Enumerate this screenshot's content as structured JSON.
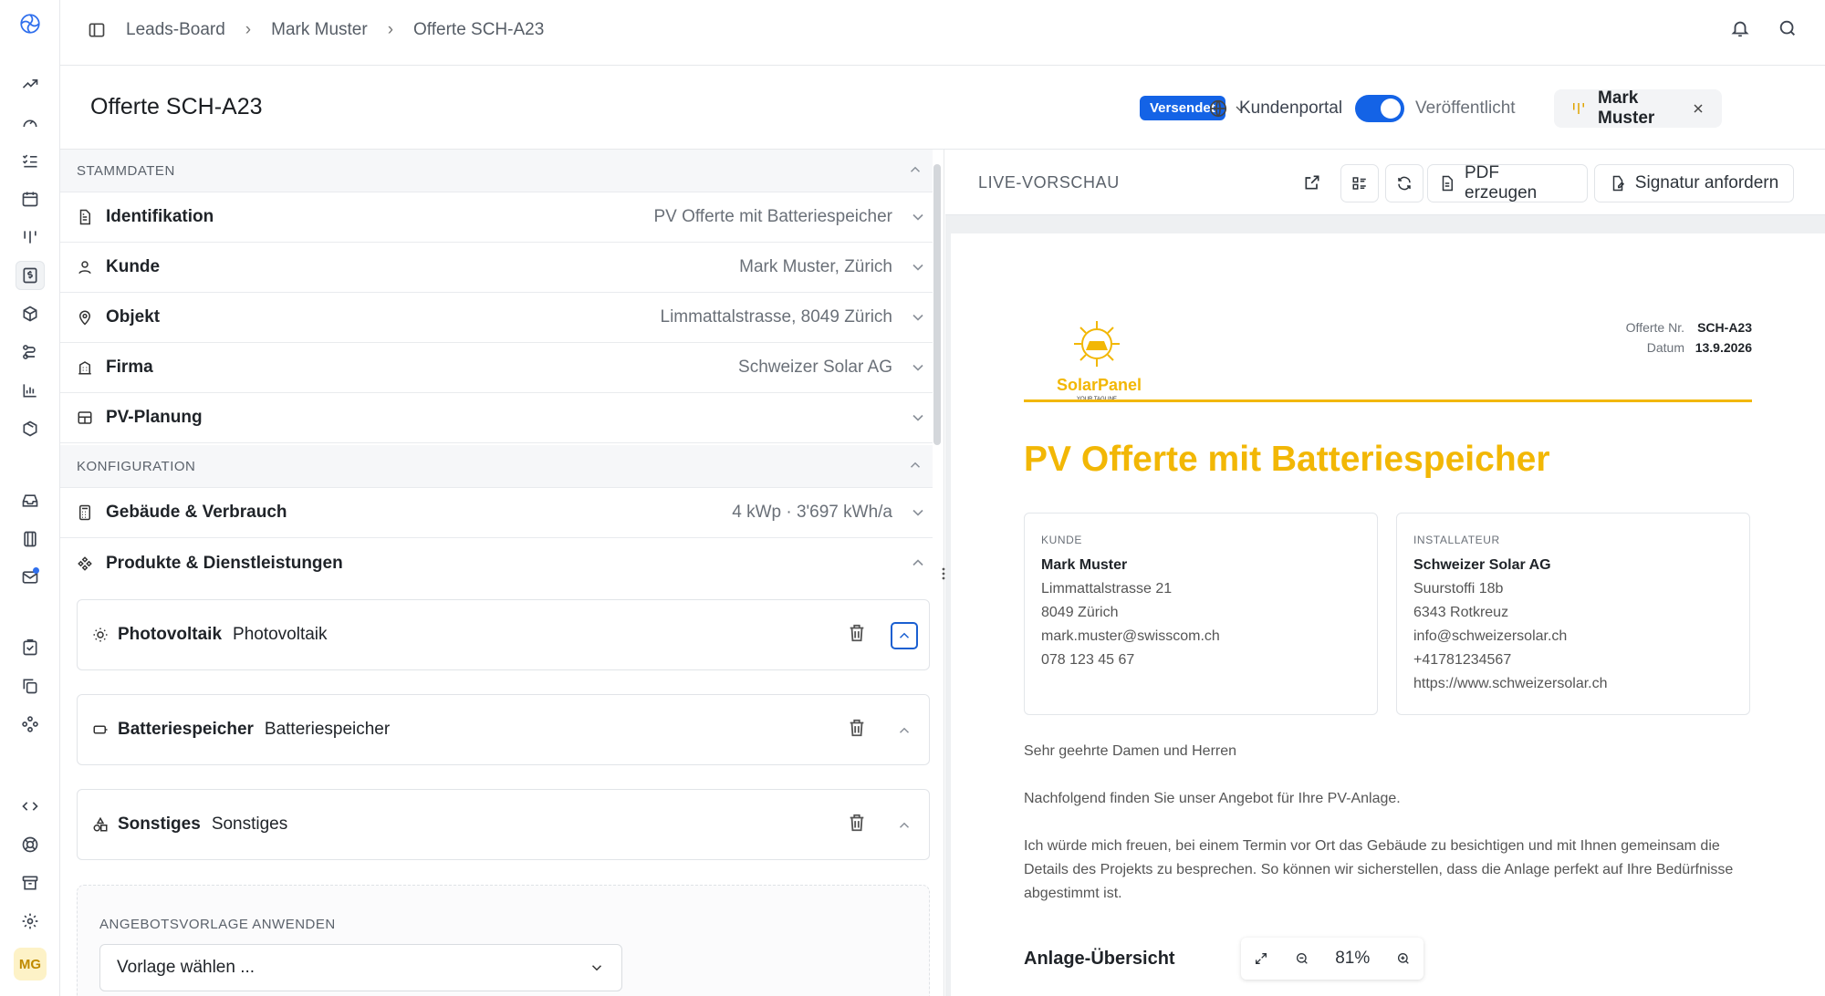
{
  "breadcrumb": [
    "Leads-Board",
    "Mark Muster",
    "Offerte SCH-A23"
  ],
  "page_title": "Offerte SCH-A23",
  "status": {
    "badge": "Versendet"
  },
  "portal": {
    "label": "Kundenportal",
    "published_label": "Veröffentlicht",
    "published": true
  },
  "user_chip": {
    "name": "Mark Muster"
  },
  "accent_color": "#1463e6",
  "brand_color": "#f2b705",
  "sections": {
    "stammdaten": {
      "title": "STAMMDATEN",
      "rows": [
        {
          "icon": "document-icon",
          "label": "Identifikation",
          "value": "PV Offerte mit Batteriespeicher"
        },
        {
          "icon": "user-icon",
          "label": "Kunde",
          "value": "Mark Muster, Zürich"
        },
        {
          "icon": "map-pin-icon",
          "label": "Objekt",
          "value": "Limmattalstrasse, 8049 Zürich"
        },
        {
          "icon": "building-icon",
          "label": "Firma",
          "value": "Schweizer Solar AG"
        },
        {
          "icon": "layout-icon",
          "label": "PV-Planung",
          "value": ""
        }
      ]
    },
    "konfiguration": {
      "title": "KONFIGURATION",
      "rows": [
        {
          "icon": "calculator-icon",
          "label": "Gebäude & Verbrauch",
          "value": "4 kWp · 3'697 kWh/a"
        },
        {
          "icon": "components-icon",
          "label": "Produkte & Dienstleistungen",
          "value": ""
        }
      ],
      "products": [
        {
          "icon": "sun-icon",
          "title": "Photovoltaik",
          "subtitle": "Photovoltaik"
        },
        {
          "icon": "battery-icon",
          "title": "Batteriespeicher",
          "subtitle": "Batteriespeicher"
        },
        {
          "icon": "shapes-icon",
          "title": "Sonstiges",
          "subtitle": "Sonstiges"
        }
      ]
    }
  },
  "template": {
    "title": "ANGEBOTSVORLAGE ANWENDEN",
    "select_value": "Vorlage wählen ..."
  },
  "preview": {
    "title": "LIVE-VORSCHAU",
    "pdf_button": "PDF erzeugen",
    "signature_button": "Signatur anfordern",
    "zoom": "81%"
  },
  "document": {
    "logo_text": "SolarPanel",
    "logo_tagline": "YOUR TAGLINE",
    "offer_no_label": "Offerte Nr.",
    "offer_no": "SCH-A23",
    "date_label": "Datum",
    "date": "13.9.2026",
    "title": "PV Offerte mit Batteriespeicher",
    "customer": {
      "caption": "KUNDE",
      "name": "Mark Muster",
      "lines": [
        "Limmattalstrasse 21",
        "8049 Zürich",
        "mark.muster@swisscom.ch",
        "078 123 45 67"
      ]
    },
    "installer": {
      "caption": "INSTALLATEUR",
      "name": "Schweizer Solar AG",
      "lines": [
        "Suurstoffi 18b",
        "6343 Rotkreuz",
        "info@schweizersolar.ch",
        "+41781234567",
        "https://www.schweizersolar.ch"
      ]
    },
    "greeting": "Sehr geehrte Damen und Herren",
    "intro": "Nachfolgend finden Sie unser Angebot für Ihre PV-Anlage.",
    "body": "Ich würde mich freuen, bei einem Termin vor Ort das Gebäude zu besichtigen und mit Ihnen gemeinsam die Details des Projekts zu besprechen. So können wir sicherstellen, dass die Anlage perfekt auf Ihre Bedürfnisse abgestimmt ist.",
    "section_title": "Anlage-Übersicht"
  }
}
